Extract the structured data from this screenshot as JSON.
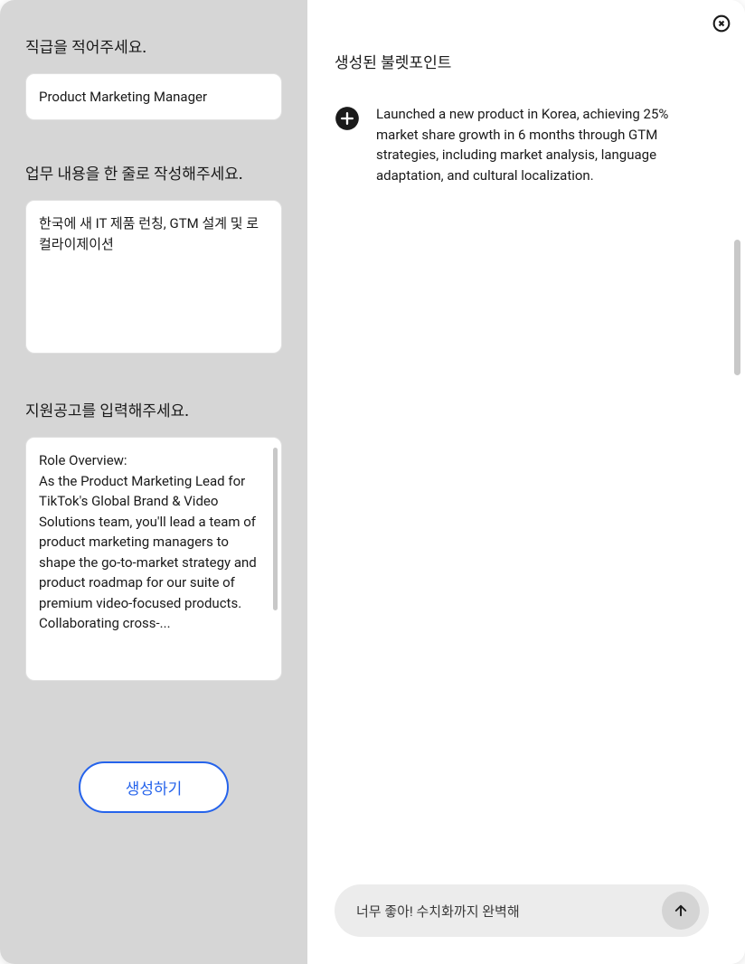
{
  "form": {
    "job_title": {
      "label": "직급을 적어주세요.",
      "value": "Product Marketing Manager"
    },
    "work_description": {
      "label": "업무 내용을 한 줄로 작성해주세요.",
      "value": "한국에 새 IT 제품 런칭, GTM 설계 및 로컬라이제이션"
    },
    "job_posting": {
      "label": "지원공고를 입력해주세요.",
      "value": "Role Overview:\nAs the Product Marketing Lead for TikTok's Global Brand & Video Solutions team, you'll lead a team of product marketing managers to shape the go-to-market strategy and product roadmap for our suite of premium video-focused products. Collaborating cross-..."
    },
    "generate_button": "생성하기"
  },
  "output": {
    "title": "생성된 불렛포인트",
    "bullets": [
      {
        "text": "Launched a new product in Korea, achieving 25% market share growth in 6 months through GTM strategies, including market analysis, language adaptation, and cultural localization."
      }
    ]
  },
  "chat": {
    "input_value": "너무 좋아! 수치화까지 완벽해"
  }
}
